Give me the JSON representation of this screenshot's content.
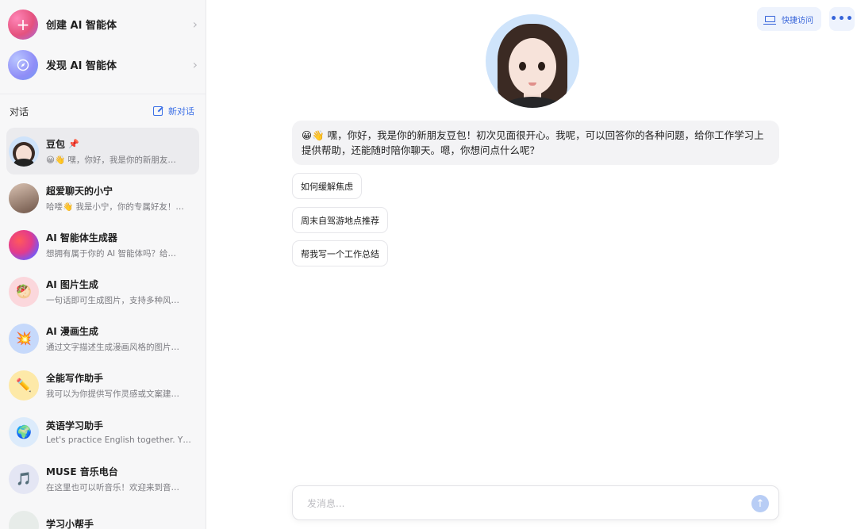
{
  "sidebar": {
    "create_label": "创建 AI 智能体",
    "discover_label": "发现 AI 智能体",
    "section_title": "对话",
    "new_chat_label": "新对话",
    "chats": [
      {
        "name": "豆包",
        "preview": "😀👋 嘿，你好，我是你的新朋友…",
        "icon": "doubao-avatar",
        "pinned": true
      },
      {
        "name": "超爱聊天的小宁",
        "preview": "哈喽👋 我是小宁，你的专属好友！…",
        "icon": "xiaoning-avatar"
      },
      {
        "name": "AI 智能体生成器",
        "preview": "想拥有属于你的 AI 智能体吗？给…",
        "icon": "gradient-orb-icon"
      },
      {
        "name": "AI 图片生成",
        "preview": "一句话即可生成图片，支持多种风…",
        "icon": "🥙"
      },
      {
        "name": "AI 漫画生成",
        "preview": "通过文字描述生成漫画风格的图片…",
        "icon": "💥"
      },
      {
        "name": "全能写作助手",
        "preview": "我可以为你提供写作灵感或文案建…",
        "icon": "✏️"
      },
      {
        "name": "英语学习助手",
        "preview": "Let's practice English together. Y…",
        "icon": "🌍"
      },
      {
        "name": "MUSE 音乐电台",
        "preview": "在这里也可以听音乐！欢迎来到音…",
        "icon": "🎵"
      },
      {
        "name": "学习小帮手",
        "preview": "",
        "icon": "study-avatar"
      }
    ]
  },
  "header": {
    "quick_access_label": "快捷访问",
    "more_label": "•••"
  },
  "conversation": {
    "greeting": "😀👋 嘿，你好，我是你的新朋友豆包！初次见面很开心。我呢，可以回答你的各种问题，给你工作学习上提供帮助，还能随时陪你聊天。嗯，你想问点什么呢？",
    "suggestions": [
      "如何缓解焦虑",
      "周末自驾游地点推荐",
      "帮我写一个工作总结"
    ]
  },
  "input": {
    "placeholder": "发消息...",
    "send_icon": "↑"
  }
}
